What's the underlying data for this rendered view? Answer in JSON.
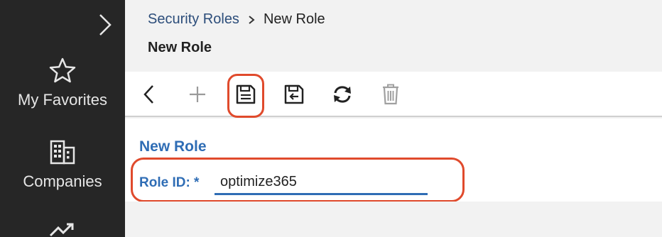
{
  "sidebar": {
    "expand_icon": "chevron-right-icon",
    "items": [
      {
        "label": "My Favorites",
        "icon": "star-icon"
      },
      {
        "label": "Companies",
        "icon": "building-icon"
      },
      {
        "label": "",
        "icon": "trending-up-icon"
      }
    ]
  },
  "breadcrumb": {
    "parent": "Security Roles",
    "current": "New Role"
  },
  "page": {
    "title": "New Role"
  },
  "toolbar": {
    "buttons": [
      {
        "name": "back",
        "icon": "chevron-left-icon"
      },
      {
        "name": "add",
        "icon": "plus-icon"
      },
      {
        "name": "save",
        "icon": "save-icon"
      },
      {
        "name": "save-and-close",
        "icon": "save-close-icon"
      },
      {
        "name": "refresh",
        "icon": "refresh-icon"
      },
      {
        "name": "delete",
        "icon": "trash-icon"
      }
    ]
  },
  "form": {
    "section_title": "New Role",
    "role_id_label": "Role ID: *",
    "role_id_value": "optimize365"
  },
  "colors": {
    "sidebar_bg": "#262626",
    "accent_blue": "#2f6db5",
    "link_blue": "#2c4d7a",
    "highlight_red": "#e04a2c"
  }
}
